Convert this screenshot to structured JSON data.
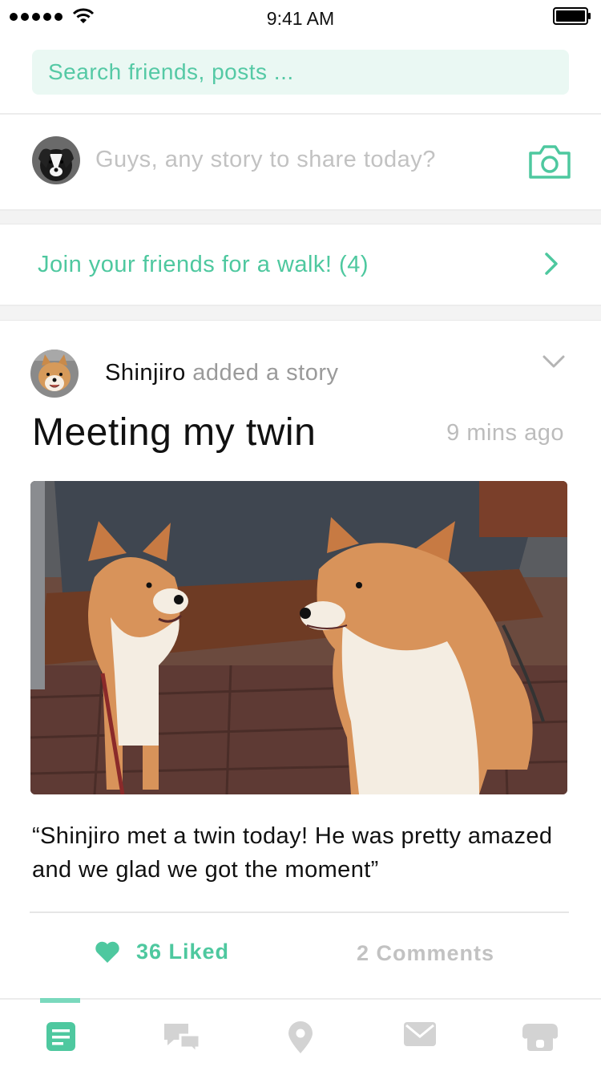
{
  "status": {
    "time": "9:41 AM"
  },
  "search": {
    "placeholder": "Search friends, posts ..."
  },
  "compose": {
    "prompt": "Guys, any story to share today?",
    "camera_icon": "camera-icon"
  },
  "walk_banner": {
    "text": "Join your friends for a walk! (4)",
    "icon": "chevron-right-icon"
  },
  "post": {
    "author": "Shinjiro",
    "action": "added a story",
    "title": "Meeting my twin",
    "time": "9 mins ago",
    "caption": "“Shinjiro met a twin today! He was pretty amazed and we glad we got the moment”",
    "likes": "36 Liked",
    "comments": "2 Comments"
  },
  "tabbar": {
    "tabs": [
      {
        "icon": "feed-icon",
        "active": true
      },
      {
        "icon": "chat-icon",
        "active": false
      },
      {
        "icon": "location-pin-icon",
        "active": false
      },
      {
        "icon": "mail-icon",
        "active": false
      },
      {
        "icon": "dog-face-icon",
        "active": false
      }
    ]
  },
  "colors": {
    "accent": "#4ec89f",
    "accent_light": "#eaf8f3",
    "inactive": "#d3d3d3",
    "muted_text": "#9a9a9a"
  }
}
